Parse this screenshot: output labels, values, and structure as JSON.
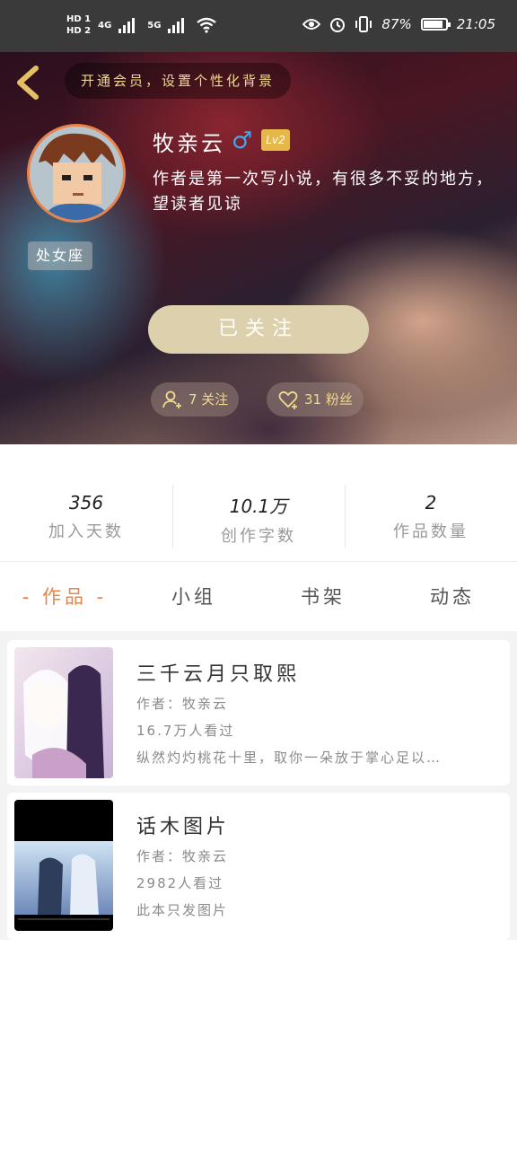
{
  "status_bar": {
    "hd1": "HD 1",
    "hd2": "HD 2",
    "net1": "4G",
    "net2": "5G",
    "battery_percent": "87%",
    "battery_level": 0.87,
    "time": "21:05"
  },
  "header": {
    "vip_prompt": "开通会员，设置个性化背景",
    "username": "牧亲云",
    "gender_symbol": "♂",
    "level": "Lv2",
    "bio": "作者是第一次写小说，有很多不妥的地方，望读者见谅",
    "zodiac": "处女座",
    "follow_button": "已关注",
    "following_chip": "7 关注",
    "fans_chip": "31 粉丝"
  },
  "stats": [
    {
      "value": "356",
      "label": "加入天数"
    },
    {
      "value": "10.1万",
      "label": "创作字数"
    },
    {
      "value": "2",
      "label": "作品数量"
    }
  ],
  "tabs": [
    "- 作品 -",
    "小组",
    "书架",
    "动态"
  ],
  "works": [
    {
      "title": "三千云月只取熙",
      "author": "作者：牧亲云",
      "views": "16.7万人看过",
      "desc": "纵然灼灼桃花十里，取你一朵放于掌心足以…"
    },
    {
      "title": "话木图片",
      "author": "作者：牧亲云",
      "views": "2982人看过",
      "desc": "此本只发图片"
    }
  ],
  "colors": {
    "accent": "#e8844a",
    "vip_gold": "#f1d88a",
    "follow_button": "#ddd1ad"
  }
}
